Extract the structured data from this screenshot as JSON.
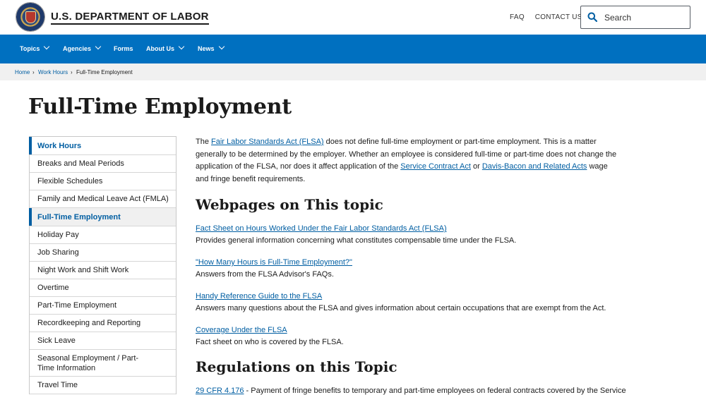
{
  "header": {
    "brand": "U.S. DEPARTMENT OF LABOR",
    "links": [
      "FAQ",
      "CONTACT US"
    ],
    "search_placeholder": "Search"
  },
  "nav": {
    "items": [
      {
        "label": "Topics",
        "dropdown": true
      },
      {
        "label": "Agencies",
        "dropdown": true
      },
      {
        "label": "Forms",
        "dropdown": false
      },
      {
        "label": "About Us",
        "dropdown": true
      },
      {
        "label": "News",
        "dropdown": true
      }
    ]
  },
  "breadcrumb": {
    "items": [
      "Home",
      "Work Hours",
      "Full-Time Employment"
    ]
  },
  "page": {
    "title": "Full-Time Employment"
  },
  "sidebar": {
    "items": [
      "Work Hours",
      "Breaks and Meal Periods",
      "Flexible Schedules",
      "Family and Medical Leave Act (FMLA)",
      "Full-Time Employment",
      "Holiday Pay",
      "Job Sharing",
      "Night Work and Shift Work",
      "Overtime",
      "Part-Time Employment",
      "Recordkeeping and Reporting",
      "Sick Leave",
      "Seasonal Employment / Part-Time Information",
      "Travel Time"
    ]
  },
  "intro": {
    "t1": "The ",
    "l1": "Fair Labor Standards Act (FLSA)",
    "t2": " does not define full-time employment or part-time employment. This is a matter generally to be determined by the employer. Whether an employee is considered full-time or part-time does not change the application of the FLSA, nor does it affect application of the ",
    "l2": "Service Contract Act",
    "t3": " or ",
    "l3": "Davis-Bacon and Related Acts",
    "t4": " wage and fringe benefit requirements."
  },
  "webpages": {
    "heading": "Webpages on This topic",
    "items": [
      {
        "link": "Fact Sheet on Hours Worked Under the Fair Labor Standards Act (FLSA)",
        "desc": "Provides general information concerning what constitutes compensable time under the FLSA."
      },
      {
        "link": "\"How Many Hours is Full-Time Employment?\"",
        "desc": "Answers from the FLSA Advisor's FAQs."
      },
      {
        "link": "Handy Reference Guide to the FLSA",
        "desc": "Answers many questions about the FLSA and gives information about certain occupations that are exempt from the Act."
      },
      {
        "link": "Coverage Under the FLSA",
        "desc": "Fact sheet on who is covered by the FLSA."
      }
    ]
  },
  "regulations": {
    "heading": "Regulations on this Topic",
    "first_link": "29 CFR 4.176",
    "first_text": " - Payment of fringe benefits to temporary and part-time employees on federal contracts covered by the Service"
  },
  "colors": {
    "nav_bg": "#0070c0",
    "link": "#005ea2",
    "breadcrumb_bg": "#f0f0f0"
  }
}
